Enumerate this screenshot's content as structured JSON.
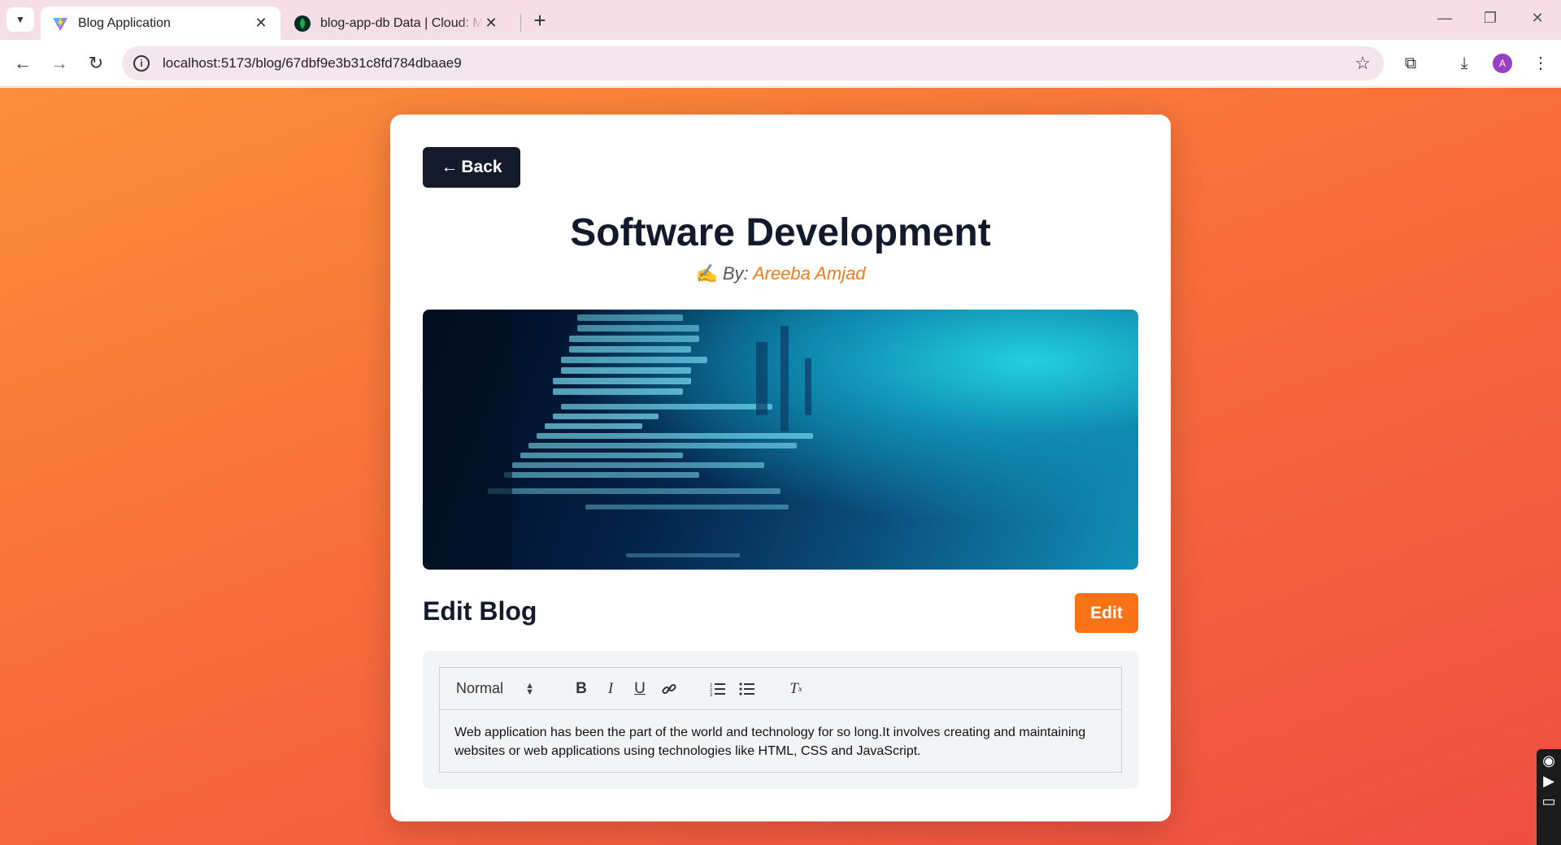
{
  "browser": {
    "tabs": [
      {
        "title": "Blog Application",
        "active": true,
        "favicon": "vite-logo-icon"
      },
      {
        "title": "blog-app-db Data | Cloud: MongoDB Cloud",
        "active": false,
        "favicon": "mongodb-leaf-icon"
      }
    ],
    "new_tab_symbol": "+",
    "close_symbol": "✕",
    "url": "localhost:5173/blog/67dbf9e3b31c8fd784dbaae9",
    "profile_initial": "A",
    "icons": [
      "back-icon",
      "forward-icon",
      "reload-icon",
      "site-info-icon",
      "bookmark-star-icon",
      "extensions-icon",
      "download-icon",
      "menu-icon",
      "minimize-icon",
      "restore-icon",
      "close-icon"
    ]
  },
  "post": {
    "back_label": "Back",
    "back_arrow": "←",
    "title": "Software Development",
    "by_prefix": "By:",
    "author": "Areeba Amjad",
    "byline_emoji": "✍️"
  },
  "editor": {
    "section_title": "Edit Blog",
    "edit_label": "Edit",
    "format_value": "Normal",
    "content": "Web application has been the part of the world and technology for so long.It involves creating and maintaining websites or web applications using technologies like HTML, CSS and JavaScript."
  },
  "colors": {
    "accent": "#f97316",
    "dark_button": "#121a2b",
    "author": "#f57a1b",
    "page_gradient_start": "#fb8f3a",
    "page_gradient_end": "#ef4e43"
  }
}
